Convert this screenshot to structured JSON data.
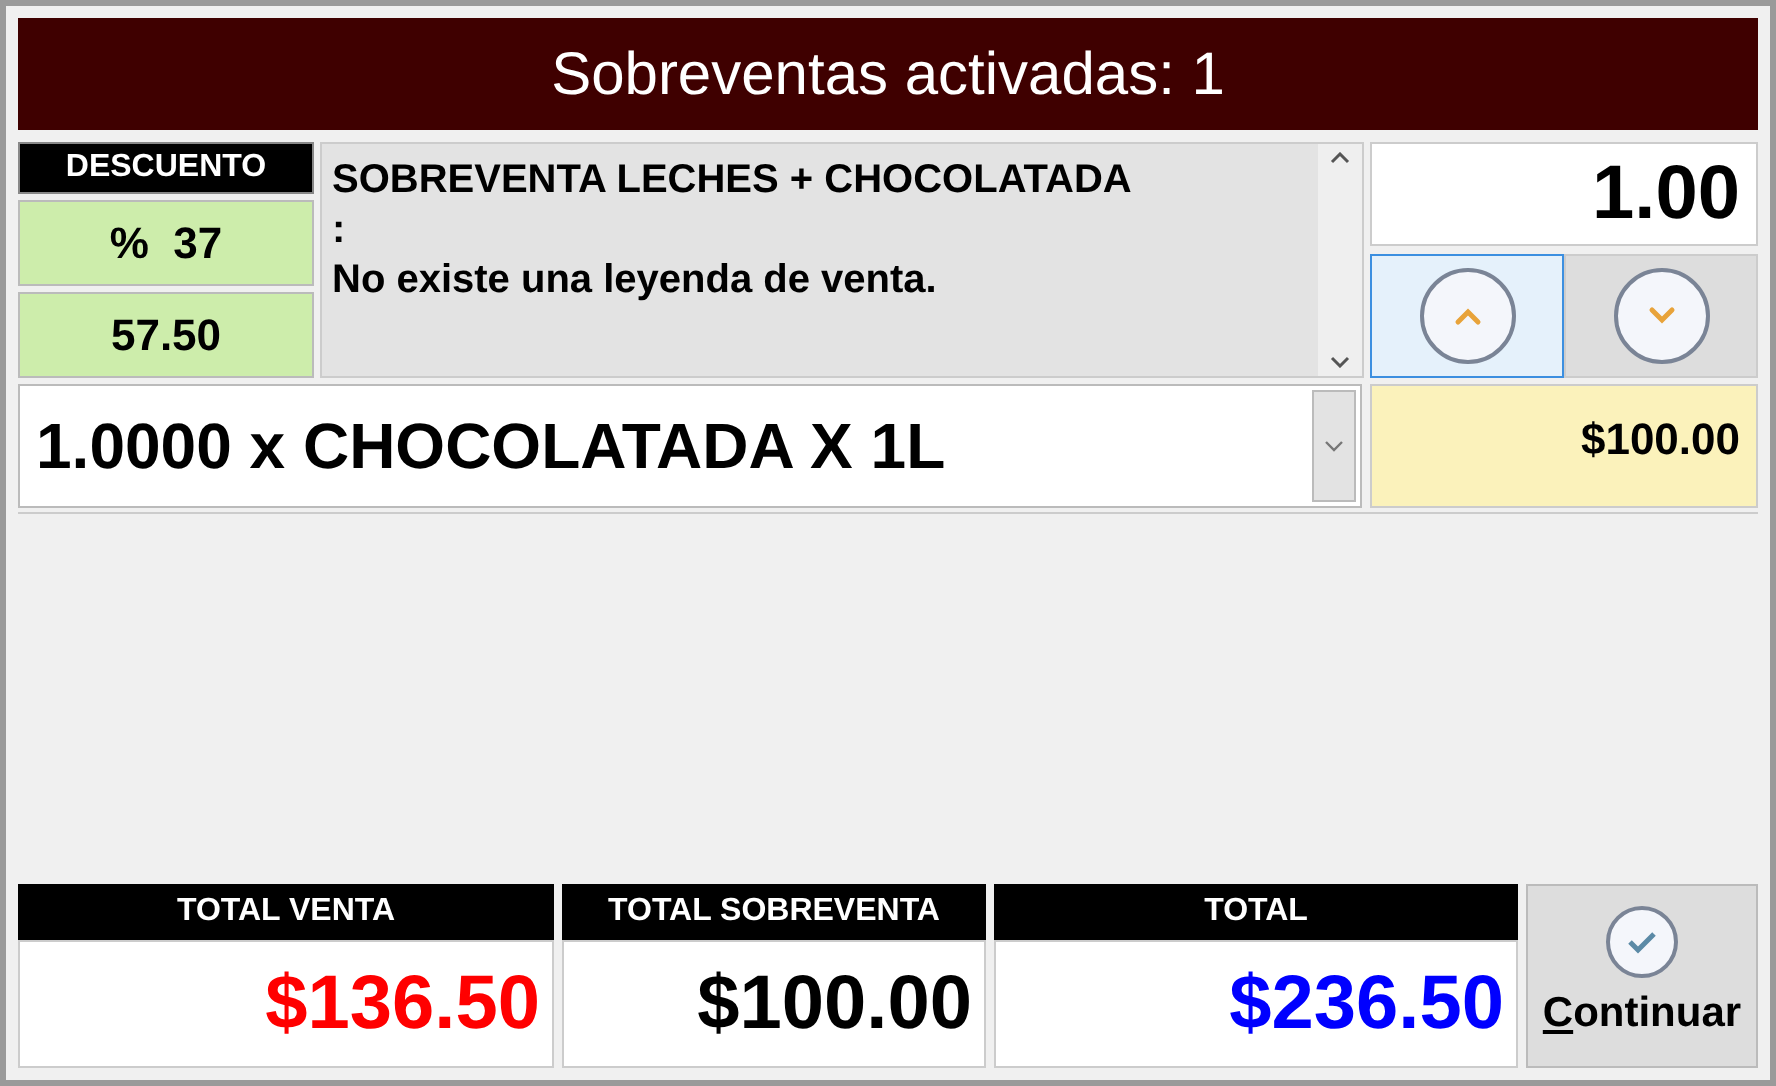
{
  "title": "Sobreventas activadas: 1",
  "discount": {
    "header": "DESCUENTO",
    "percent": "%  37",
    "amount": "57.50"
  },
  "promo": {
    "lines": [
      "SOBREVENTA LECHES + CHOCOLATADA",
      ":",
      "No existe una leyenda de venta."
    ]
  },
  "quantity": {
    "value": "1.00"
  },
  "stepper": [
    {
      "kind": "up",
      "selected": true
    },
    {
      "kind": "down",
      "selected": false
    }
  ],
  "product": {
    "value": "1.0000 x CHOCOLATADA X 1L"
  },
  "price": "$100.00",
  "totals": [
    {
      "label": "TOTAL VENTA",
      "value": "$136.50",
      "color": "#ff0000"
    },
    {
      "label": "TOTAL SOBREVENTA",
      "value": "$100.00",
      "color": "#000000"
    },
    {
      "label": "TOTAL",
      "value": "$236.50",
      "color": "#0000ff"
    }
  ],
  "continue_button": {
    "label": "Continuar"
  }
}
